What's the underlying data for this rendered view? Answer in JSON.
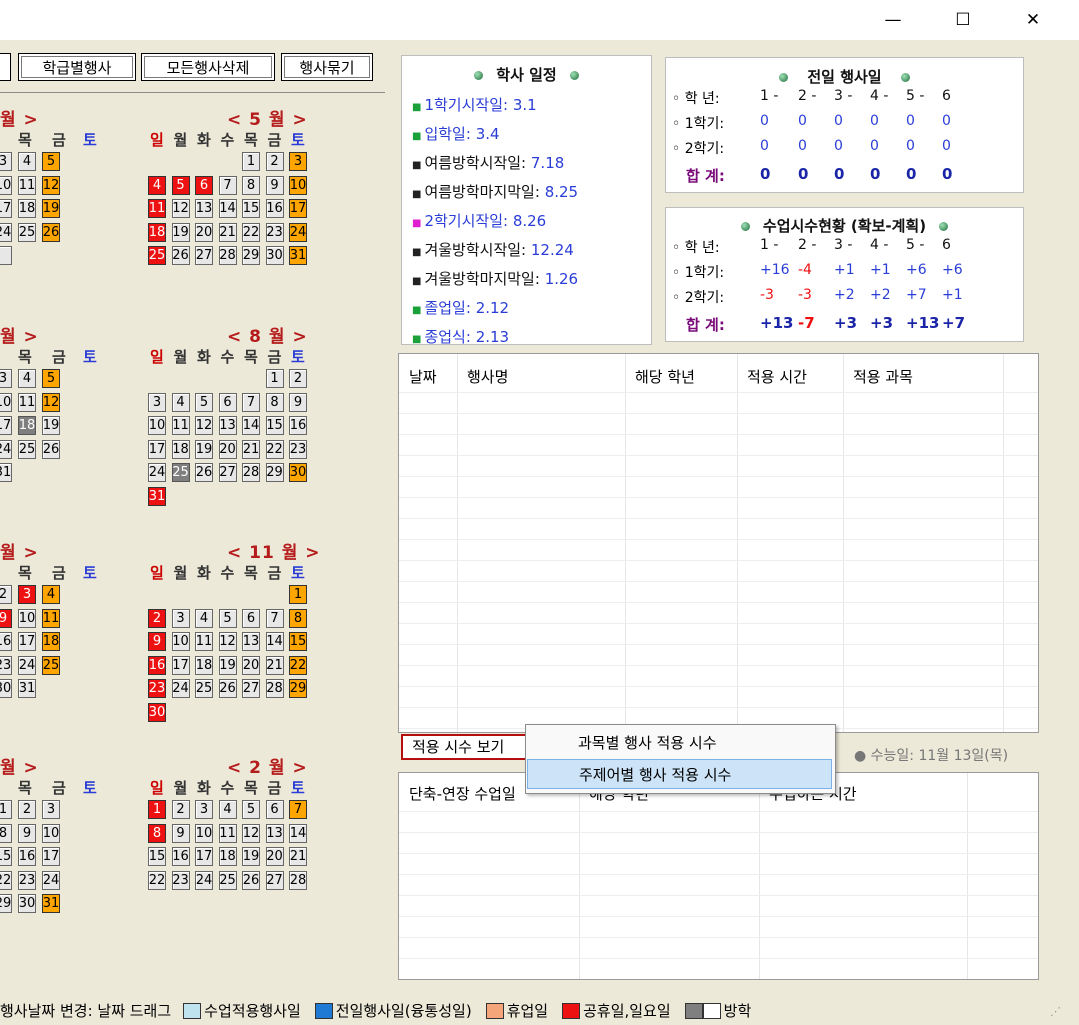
{
  "window": {
    "minimize_glyph": "—",
    "maximize_glyph": "☐",
    "close_glyph": "✕"
  },
  "toolbar": {
    "buttons": [
      "학급별행사",
      "모든행사삭제",
      "행사묶기"
    ]
  },
  "weekdays": [
    "일",
    "월",
    "화",
    "수",
    "목",
    "금",
    "토"
  ],
  "calendar": {
    "partial_titles": [
      "월 >",
      "월 >",
      "월 >",
      "월 >"
    ],
    "partial_weekdays": [
      "목",
      "금",
      "토"
    ],
    "partial_rows": [
      [
        [
          {
            "d": "3"
          },
          {
            "d": "4"
          },
          {
            "d": "5",
            "c": "orange"
          }
        ],
        [
          {
            "d": "10"
          },
          {
            "d": "11"
          },
          {
            "d": "12",
            "c": "orange"
          }
        ],
        [
          {
            "d": "17"
          },
          {
            "d": "18"
          },
          {
            "d": "19",
            "c": "orange"
          }
        ],
        [
          {
            "d": "24"
          },
          {
            "d": "25"
          },
          {
            "d": "26",
            "c": "orange"
          }
        ],
        [
          {
            "d": ""
          }
        ]
      ],
      [
        [
          {
            "d": "3"
          },
          {
            "d": "4"
          },
          {
            "d": "5",
            "c": "orange"
          }
        ],
        [
          {
            "d": "10"
          },
          {
            "d": "11"
          },
          {
            "d": "12",
            "c": "orange"
          }
        ],
        [
          {
            "d": "17"
          },
          {
            "d": "18",
            "c": "gray"
          },
          {
            "d": "19"
          }
        ],
        [
          {
            "d": "24"
          },
          {
            "d": "25"
          },
          {
            "d": "26"
          }
        ],
        [
          {
            "d": "31"
          }
        ]
      ],
      [
        [
          {
            "d": "2"
          },
          {
            "d": "3",
            "c": "red"
          },
          {
            "d": "4",
            "c": "orange"
          }
        ],
        [
          {
            "d": "9",
            "c": "red"
          },
          {
            "d": "10"
          },
          {
            "d": "11",
            "c": "orange"
          }
        ],
        [
          {
            "d": "16"
          },
          {
            "d": "17"
          },
          {
            "d": "18",
            "c": "orange"
          }
        ],
        [
          {
            "d": "23"
          },
          {
            "d": "24"
          },
          {
            "d": "25",
            "c": "orange"
          }
        ],
        [
          {
            "d": "30"
          },
          {
            "d": "31"
          }
        ]
      ],
      [
        [
          {
            "d": "1"
          },
          {
            "d": "2"
          },
          {
            "d": "3"
          }
        ],
        [
          {
            "d": "8"
          },
          {
            "d": "9"
          },
          {
            "d": "10"
          }
        ],
        [
          {
            "d": "15"
          },
          {
            "d": "16"
          },
          {
            "d": "17"
          }
        ],
        [
          {
            "d": "22"
          },
          {
            "d": "23"
          },
          {
            "d": "24"
          }
        ],
        [
          {
            "d": "29"
          },
          {
            "d": "30"
          },
          {
            "d": "31",
            "c": "orange"
          }
        ]
      ]
    ],
    "months": [
      {
        "title": "< 5 월 >",
        "start": 4,
        "days": 31,
        "red": [
          4,
          5,
          6,
          11,
          18,
          25
        ],
        "orange": [
          3,
          10,
          17,
          24,
          31
        ],
        "gray": []
      },
      {
        "title": "< 8 월 >",
        "start": 5,
        "days": 31,
        "red": [
          31
        ],
        "orange": [
          30
        ],
        "gray": [
          25
        ]
      },
      {
        "title": "< 11 월 >",
        "start": 6,
        "days": 30,
        "red": [
          2,
          9,
          16,
          23,
          30
        ],
        "orange": [
          1,
          8,
          15,
          22,
          29
        ],
        "gray": []
      },
      {
        "title": "< 2 월 >",
        "start": 0,
        "days": 28,
        "red": [
          1,
          8
        ],
        "orange": [
          7
        ],
        "gray": []
      }
    ]
  },
  "schedule": {
    "title": "학사 일정",
    "items": [
      {
        "label": "1학기시작일:",
        "value": "3.1",
        "bullet_color": "#1aa13a",
        "label_color": "#2a3dd6",
        "value_color": "#2a3dd6"
      },
      {
        "label": "입학일:",
        "value": "3.4",
        "bullet_color": "#1aa13a",
        "label_color": "#2a3dd6",
        "value_color": "#2a3dd6"
      },
      {
        "label": "여름방학시작일:",
        "value": "7.18",
        "bullet_color": "#222222",
        "label_color": "#111111",
        "value_color": "#2a3dd6"
      },
      {
        "label": "여름방학마지막일:",
        "value": "8.25",
        "bullet_color": "#222222",
        "label_color": "#111111",
        "value_color": "#2a3dd6"
      },
      {
        "label": "2학기시작일:",
        "value": "8.26",
        "bullet_color": "#e020d0",
        "label_color": "#2a3dd6",
        "value_color": "#2a3dd6"
      },
      {
        "label": "겨울방학시작일:",
        "value": "12.24",
        "bullet_color": "#222222",
        "label_color": "#111111",
        "value_color": "#2a3dd6"
      },
      {
        "label": "겨울방학마지막일:",
        "value": "1.26",
        "bullet_color": "#222222",
        "label_color": "#111111",
        "value_color": "#2a3dd6"
      },
      {
        "label": "졸업일:",
        "value": "2.12",
        "bullet_color": "#1aa13a",
        "label_color": "#2a3dd6",
        "value_color": "#2a3dd6"
      },
      {
        "label": "종업식:",
        "value": "2.13",
        "bullet_color": "#1aa13a",
        "label_color": "#2a3dd6",
        "value_color": "#2a3dd6"
      }
    ]
  },
  "allday": {
    "title": "전일 행사일",
    "grade_label": "학 년:",
    "grades": [
      "1 -",
      "2 -",
      "3 -",
      "4 -",
      "5 -",
      "6"
    ],
    "sem1_label": "1학기:",
    "sem1": [
      "0",
      "0",
      "0",
      "0",
      "0",
      "0"
    ],
    "sem2_label": "2학기:",
    "sem2": [
      "0",
      "0",
      "0",
      "0",
      "0",
      "0"
    ],
    "total_label": "합 계:",
    "total": [
      "0",
      "0",
      "0",
      "0",
      "0",
      "0"
    ]
  },
  "hours": {
    "title": "수업시수현황 (확보-계획)",
    "grade_label": "학 년:",
    "grades": [
      "1 -",
      "2 -",
      "3 -",
      "4 -",
      "5 -",
      "6"
    ],
    "sem1_label": "1학기:",
    "sem1": [
      "+16",
      "-4",
      "+1",
      "+1",
      "+6",
      "+6"
    ],
    "sem2_label": "2학기:",
    "sem2": [
      "-3",
      "-3",
      "+2",
      "+2",
      "+7",
      "+1"
    ],
    "total_label": "합 계:",
    "total": [
      "+13",
      "-7",
      "+3",
      "+3",
      "+13",
      "+7"
    ]
  },
  "event_list": {
    "headers": [
      "날짜",
      "행사명",
      "해당 학년",
      "적용 시간",
      "적용 과목"
    ]
  },
  "apply_button": "적용 시수 보기",
  "context_menu": {
    "items": [
      "과목별 행사 적용 시수",
      "주제어별 행사 적용 시수"
    ]
  },
  "suneung": "● 수능일: 11월 13일(목)",
  "short_list": {
    "headers": [
      "단축-연장 수업일",
      "해당 학년",
      "수업하는 시간"
    ]
  },
  "legend": {
    "drag_text": "행사날짜 변경: 날짜 드래그",
    "items": [
      {
        "label": "수업적용행사일",
        "color": "#bfe3ef"
      },
      {
        "label": "전일행사일(융통성일)",
        "color": "#1f7ad6"
      },
      {
        "label": "휴업일",
        "color": "#f4a57a"
      },
      {
        "label": "공휴일,일요일",
        "color": "#ee1111"
      },
      {
        "label": "방학",
        "color": "#7f7f7f"
      }
    ]
  }
}
